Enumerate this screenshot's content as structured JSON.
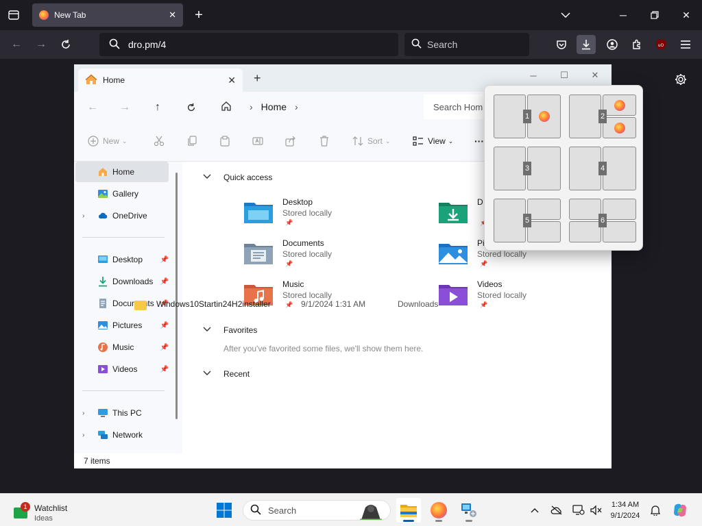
{
  "browser": {
    "tab": {
      "title": "New Tab"
    },
    "url": "dro.pm/4",
    "search_placeholder": "Search",
    "ublock_label": "uO"
  },
  "explorer": {
    "tab_title": "Home",
    "breadcrumb": [
      "Home"
    ],
    "search_placeholder": "Search Hom",
    "commands": {
      "new": "New",
      "sort": "Sort",
      "view": "View",
      "more": "···"
    },
    "nav": {
      "top": [
        {
          "label": "Home",
          "icon": "home-icon"
        },
        {
          "label": "Gallery",
          "icon": "gallery-icon"
        },
        {
          "label": "OneDrive",
          "icon": "onedrive-icon"
        }
      ],
      "pinned": [
        {
          "label": "Desktop",
          "icon": "desktop-icon"
        },
        {
          "label": "Downloads",
          "icon": "downloads-icon"
        },
        {
          "label": "Documents",
          "icon": "documents-icon"
        },
        {
          "label": "Pictures",
          "icon": "pictures-icon"
        },
        {
          "label": "Music",
          "icon": "music-icon"
        },
        {
          "label": "Videos",
          "icon": "videos-icon"
        }
      ],
      "bottom": [
        {
          "label": "This PC",
          "icon": "this-pc-icon"
        },
        {
          "label": "Network",
          "icon": "network-icon"
        }
      ]
    },
    "status": "7 items",
    "sections": {
      "quick_access": "Quick access",
      "favorites": "Favorites",
      "favorites_empty": "After you've favorited some files, we'll show them here.",
      "recent": "Recent"
    },
    "quick_access": [
      {
        "name": "Desktop",
        "sub": "Stored locally",
        "color": "#2a9fe0"
      },
      {
        "name": "D",
        "sub": "",
        "color": "#1aa37a"
      },
      {
        "name": "Documents",
        "sub": "Stored locally",
        "color": "#8fa3b8"
      },
      {
        "name": "Pi",
        "sub": "Stored locally",
        "color": "#2d8fe0"
      },
      {
        "name": "Music",
        "sub": "Stored locally",
        "color": "#e8734a"
      },
      {
        "name": "Videos",
        "sub": "Stored locally",
        "color": "#8a4fd6"
      }
    ],
    "recent": [
      {
        "name": "Windows10Startin24H2installer",
        "date": "9/1/2024 1:31 AM",
        "location": "Downloads"
      }
    ]
  },
  "snap_layouts": [
    "1",
    "2",
    "3",
    "4",
    "5",
    "6"
  ],
  "taskbar": {
    "widget": {
      "title": "Watchlist",
      "subtitle": "Ideas",
      "badge": "1"
    },
    "search_placeholder": "Search",
    "time": "1:34 AM",
    "date": "9/1/2024"
  }
}
